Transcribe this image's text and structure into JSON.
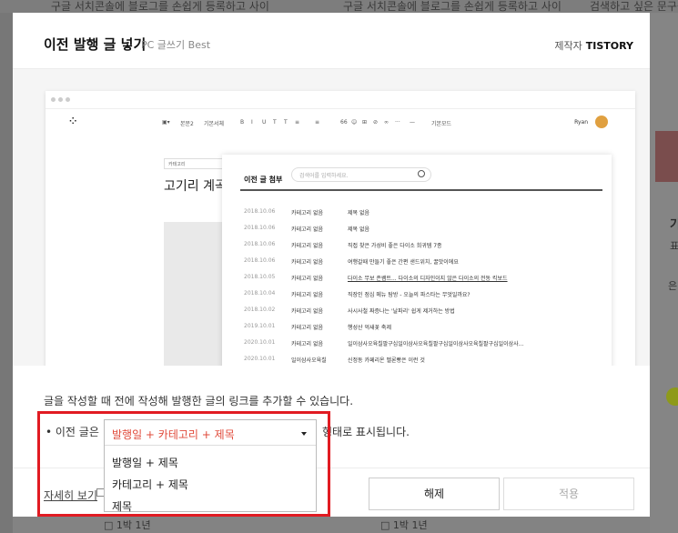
{
  "background": {
    "top_texts": [
      "구글 서치콘솔에 블로그를 손쉽게 등록하고 사이",
      "구글 서치콘솔에 블로그를 손쉽게 등록하고 사이",
      "검색하고 싶은 문구를"
    ],
    "right_texts": [
      "기",
      "표",
      "은"
    ]
  },
  "modal": {
    "title": "이전 발행 글 넣기",
    "subtitle": "PC 글쓰기 Best",
    "maker_label": "제작자",
    "maker_name": "TISTORY"
  },
  "preview": {
    "toolbar_items": [
      "본문2",
      "기본서체",
      "B",
      "I",
      "U",
      "T",
      "T",
      "≡",
      "≡",
      "66",
      "☺",
      "⊞",
      "⊘",
      "∞",
      "···",
      "—",
      "기본모드"
    ],
    "author": "Ryan",
    "category_select": "카테고리",
    "doc_title": "고기리 계곡 브런",
    "attach_title": "이전 글 첨부",
    "search_placeholder": "검색어를 입력하세요.",
    "rows": [
      {
        "date": "2018.10.06",
        "category": "카테고리 없음",
        "title": "제목 없음"
      },
      {
        "date": "2018.10.06",
        "category": "카테고리 없음",
        "title": "제목 없음"
      },
      {
        "date": "2018.10.06",
        "category": "카테고리 없음",
        "title": "직접 찾은 가성비 좋은 다이소 희귀템 7종"
      },
      {
        "date": "2018.10.06",
        "category": "카테고리 없음",
        "title": "여행갈때 만들기 좋은 간편 샌드위치, 꿀맛이에요"
      },
      {
        "date": "2018.10.05",
        "category": "카테고리 없음",
        "title": "다이소 무보 존쌤트... 다이소의 디자인이지 않은 다이소의 전동 킥보드"
      },
      {
        "date": "2018.10.04",
        "category": "카테고리 없음",
        "title": "직장인 점심 메뉴 탐방 - 오늘의 파스타는 무엇일까요?"
      },
      {
        "date": "2018.10.02",
        "category": "카테고리 없음",
        "title": "사시사철 짜증나는 '날파리' 쉽게 제거하는 방법"
      },
      {
        "date": "2019.10.01",
        "category": "카테고리 없음",
        "title": "행성산 억새꽃 축제"
      },
      {
        "date": "2020.10.01",
        "category": "카테고리 없음",
        "title": "일이삼사오육칠팔구십일이삼사오육칠팔구십일이삼사오육칠팔구십일이삼사..."
      },
      {
        "date": "2020.10.01",
        "category": "일이삼사오육칠",
        "title": "신정동 카페리온 멜론빵은 이런 것"
      }
    ]
  },
  "description": "글을 작성할 때 전에 작성해 발행한 글의 링크를 추가할 수 있습니다.",
  "prev_label": "• 이전 글은",
  "suffix": "형태로 표시됩니다.",
  "dropdown": {
    "selected": "발행일 + 카테고리 + 제목",
    "options": [
      "발행일 + 제목",
      "카테고리 + 제목",
      "제목"
    ]
  },
  "footer": {
    "detail_link": "자세히 보기",
    "release_button": "해제",
    "apply_button": "적용"
  },
  "colors": {
    "highlight": "#e11b22",
    "selected_option": "#e04a3a"
  }
}
